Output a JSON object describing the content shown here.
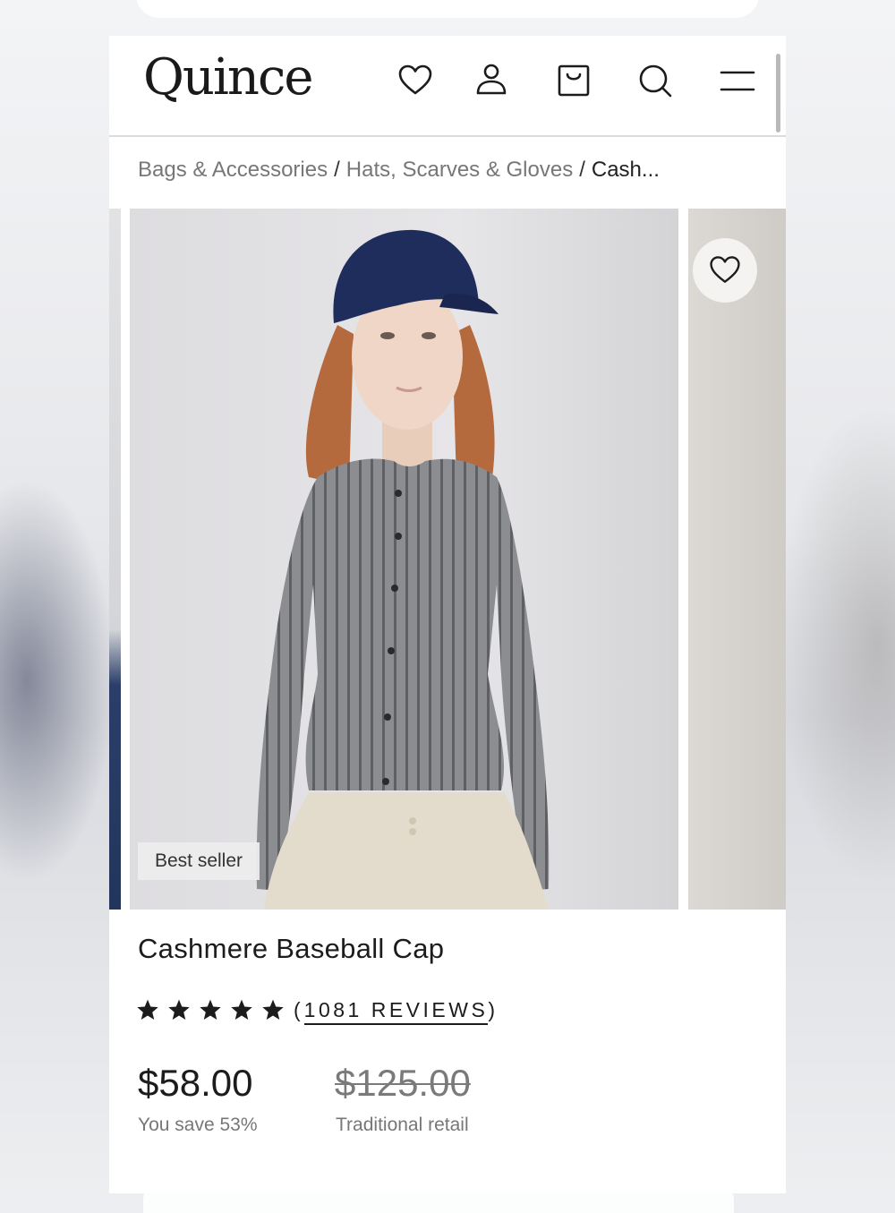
{
  "header": {
    "logo": "Quince",
    "icons": [
      "heart-icon",
      "user-icon",
      "bag-icon",
      "search-icon",
      "menu-icon"
    ]
  },
  "breadcrumb": {
    "items": [
      "Bags & Accessories",
      "Hats, Scarves & Gloves",
      "Cash..."
    ],
    "separator": "/"
  },
  "product": {
    "badge": "Best seller",
    "title": "Cashmere Baseball Cap",
    "rating": {
      "stars": 5,
      "open": "(",
      "reviews_label": "1081 REVIEWS",
      "close": ")"
    },
    "price": "$58.00",
    "savings": "You save 53%",
    "original_price": "$125.00",
    "original_label": "Traditional retail"
  },
  "colors": {
    "text": "#1c1c1c",
    "muted": "#777777",
    "cap": "#1f2d5c",
    "cardigan": "#8a8b8e",
    "pants": "#e3dccd"
  }
}
